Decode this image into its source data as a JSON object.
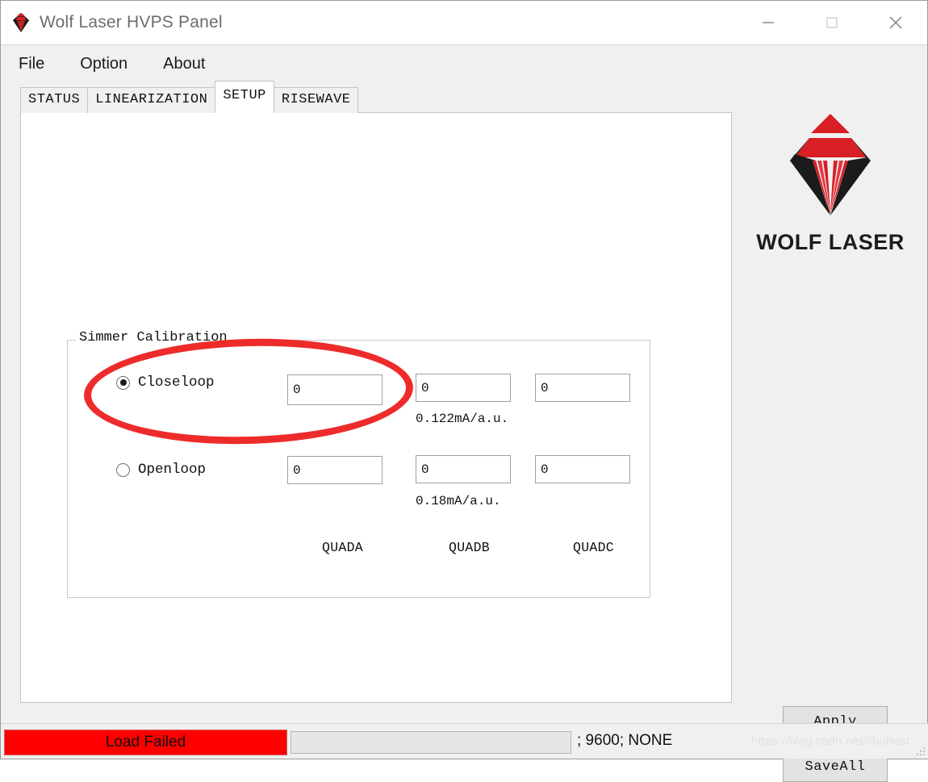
{
  "window": {
    "title": "Wolf Laser HVPS Panel",
    "icon": "wolf-laser-diamond-icon",
    "controls": {
      "minimize": "minimize-icon",
      "maximize": "maximize-icon",
      "close": "close-icon"
    }
  },
  "menubar": {
    "items": [
      {
        "label": "File"
      },
      {
        "label": "Option"
      },
      {
        "label": "About"
      }
    ]
  },
  "tabs": {
    "items": [
      {
        "label": "STATUS",
        "active": false
      },
      {
        "label": "LINEARIZATION",
        "active": false
      },
      {
        "label": "SETUP",
        "active": true
      },
      {
        "label": "RISEWAVE",
        "active": false
      }
    ]
  },
  "setup_tab": {
    "groupbox": {
      "title": "Simmer Calibration",
      "rows": [
        {
          "id": "closeloop",
          "label": "Closeloop",
          "selected": true,
          "unit": "0.122mA/a.u.",
          "values": [
            "0",
            "0",
            "0"
          ]
        },
        {
          "id": "openloop",
          "label": "Openloop",
          "selected": false,
          "unit": "0.18mA/a.u.",
          "values": [
            "0",
            "0",
            "0"
          ]
        }
      ],
      "column_labels": [
        "QUADA",
        "QUADB",
        "QUADC"
      ]
    }
  },
  "annotation": {
    "shape": "ellipse",
    "color": "#ee2b2b"
  },
  "logo": {
    "text": "WOLF LASER",
    "mark_name": "wolf-laser-diamond-logo",
    "colors": {
      "red": "#d81f26",
      "black": "#1b1b1b"
    }
  },
  "actions": {
    "apply_label": "Apply",
    "saveall_label": "SaveAll"
  },
  "statusbar": {
    "alert_text": "Load Failed",
    "alert_color": "#fe0000",
    "progress_value": "",
    "port_info": "; 9600; NONE",
    "watermark": "https://blog.csdn.net/libohust"
  }
}
